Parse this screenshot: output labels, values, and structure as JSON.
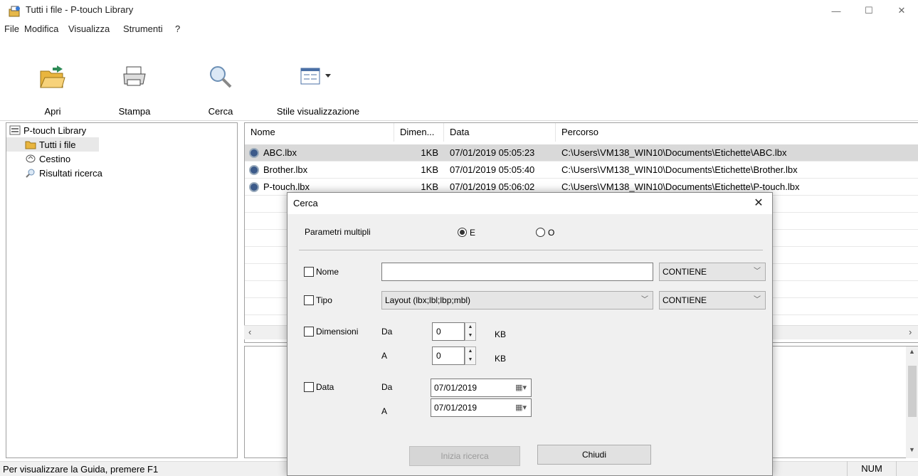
{
  "window": {
    "title": "Tutti i file - P-touch Library",
    "controls": {
      "minimize": "—",
      "maximize": "☐",
      "close": "✕"
    }
  },
  "menu": [
    "File",
    "Modifica",
    "Visualizza",
    "Strumenti",
    "?"
  ],
  "toolbar": {
    "open_label": "Apri",
    "print_label": "Stampa",
    "search_label": "Cerca",
    "view_style_label": "Stile visualizzazione"
  },
  "tree": {
    "root": "P-touch Library",
    "items": [
      "Tutti i file",
      "Cestino",
      "Risultati ricerca"
    ]
  },
  "list": {
    "columns": [
      "Nome",
      "Dimen...",
      "Data",
      "Percorso"
    ],
    "rows": [
      {
        "name": "ABC.lbx",
        "size": "1KB",
        "date": "07/01/2019 05:05:23",
        "path": "C:\\Users\\VM138_WIN10\\Documents\\Etichette\\ABC.lbx"
      },
      {
        "name": "Brother.lbx",
        "size": "1KB",
        "date": "07/01/2019 05:05:40",
        "path": "C:\\Users\\VM138_WIN10\\Documents\\Etichette\\Brother.lbx"
      },
      {
        "name": "P-touch.lbx",
        "size": "1KB",
        "date": "07/01/2019 05:06:02",
        "path": "C:\\Users\\VM138_WIN10\\Documents\\Etichette\\P-touch.lbx"
      }
    ]
  },
  "status": {
    "text": "Per visualizzare la Guida, premere F1",
    "num": "NUM"
  },
  "dialog": {
    "title": "Cerca",
    "close": "✕",
    "multi_label": "Parametri multipli",
    "radio_and": "E",
    "radio_or": "O",
    "name_label": "Nome",
    "name_value": "",
    "name_op": "CONTIENE",
    "type_label": "Tipo",
    "type_value": "Layout (lbx;lbl;lbp;mbl)",
    "type_op": "CONTIENE",
    "size_label": "Dimensioni",
    "from_label": "Da",
    "to_label": "A",
    "size_from": "0",
    "size_to": "0",
    "unit": "KB",
    "date_label": "Data",
    "date_from": "07/01/2019",
    "date_to": "07/01/2019",
    "search_btn": "Inizia ricerca",
    "close_btn": "Chiudi"
  }
}
